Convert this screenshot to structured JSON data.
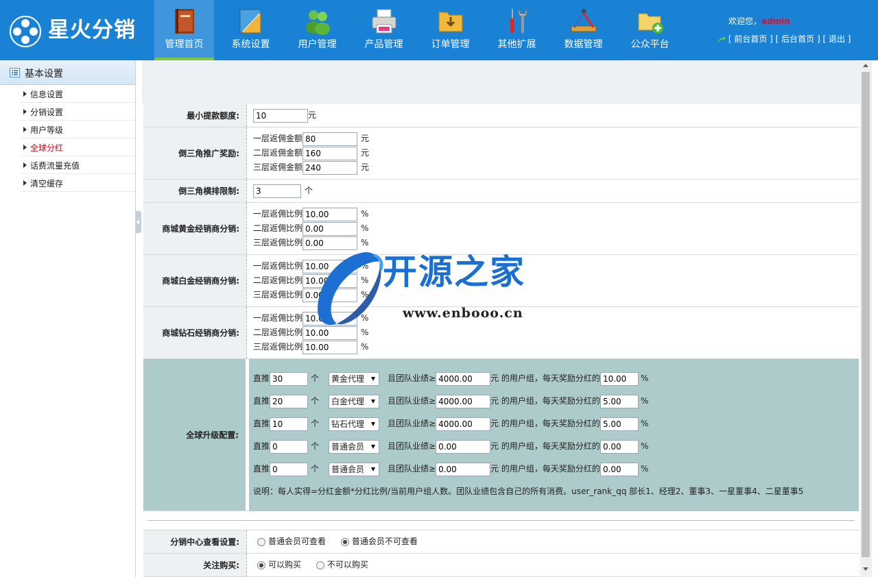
{
  "app": {
    "logo_text": "星火分销"
  },
  "nav": [
    {
      "label": "管理首页",
      "icon": "book-icon",
      "active": true
    },
    {
      "label": "系统设置",
      "icon": "ruler-icon",
      "active": false
    },
    {
      "label": "用户管理",
      "icon": "users-icon",
      "active": false
    },
    {
      "label": "产品管理",
      "icon": "printer-icon",
      "active": false
    },
    {
      "label": "订单管理",
      "icon": "folder-icon",
      "active": false
    },
    {
      "label": "其他扩展",
      "icon": "tools-icon",
      "active": false
    },
    {
      "label": "数据管理",
      "icon": "drafting-icon",
      "active": false
    },
    {
      "label": "公众平台",
      "icon": "folder-add-icon",
      "active": false
    }
  ],
  "user": {
    "welcome": "欢迎您，",
    "name": "admin",
    "links": [
      "[ 前台首页 ]",
      "[ 后台首页 ]",
      "[ 退出 ]"
    ]
  },
  "sidebar": {
    "header": "基本设置",
    "items": [
      {
        "label": "信息设置",
        "active": false
      },
      {
        "label": "分销设置",
        "active": false
      },
      {
        "label": "用户等级",
        "active": false
      },
      {
        "label": "全球分红",
        "active": true
      },
      {
        "label": "话费流量充值",
        "active": false
      },
      {
        "label": "清空缓存",
        "active": false
      }
    ]
  },
  "form": {
    "min_withdraw": {
      "label": "最小提款额度:",
      "value": "10",
      "unit": "元"
    },
    "triangle_reward": {
      "label": "倒三角推广奖励:",
      "rows": [
        {
          "sub": "一层返佣金额",
          "value": "80",
          "unit": "元"
        },
        {
          "sub": "二层返佣金额",
          "value": "160",
          "unit": "元"
        },
        {
          "sub": "三层返佣金额",
          "value": "240",
          "unit": "元"
        }
      ]
    },
    "triangle_limit": {
      "label": "倒三角横排限制:",
      "value": "3",
      "unit": "个"
    },
    "gold": {
      "label": "商城黄金经销商分销:",
      "rows": [
        {
          "sub": "一层返佣比例",
          "value": "10.00",
          "unit": "%"
        },
        {
          "sub": "二层返佣比例",
          "value": "0.00",
          "unit": "%"
        },
        {
          "sub": "三层返佣比例",
          "value": "0.00",
          "unit": "%"
        }
      ]
    },
    "platinum": {
      "label": "商城白金经销商分销:",
      "rows": [
        {
          "sub": "一层返佣比例",
          "value": "10.00",
          "unit": "%"
        },
        {
          "sub": "二层返佣比例",
          "value": "10.00",
          "unit": "%"
        },
        {
          "sub": "三层返佣比例",
          "value": "0.00",
          "unit": "%"
        }
      ]
    },
    "diamond": {
      "label": "商城钻石经销商分销:",
      "rows": [
        {
          "sub": "一层返佣比例",
          "value": "10.00",
          "unit": "%"
        },
        {
          "sub": "二层返佣比例",
          "value": "10.00",
          "unit": "%"
        },
        {
          "sub": "三层返佣比例",
          "value": "10.00",
          "unit": "%"
        }
      ]
    },
    "global_upgrade": {
      "label": "全球升级配置:",
      "text_direct": "直推",
      "text_unit": "个",
      "text_team": "且团队业绩≥",
      "text_group": "元 的用户组，",
      "text_daily": "每天奖励分红的",
      "text_percent": "%",
      "rows": [
        {
          "count": "30",
          "group": "黄金代理",
          "amount": "4000.00",
          "rate": "10.00"
        },
        {
          "count": "20",
          "group": "白金代理",
          "amount": "4000.00",
          "rate": "5.00"
        },
        {
          "count": "10",
          "group": "钻石代理",
          "amount": "4000.00",
          "rate": "5.00"
        },
        {
          "count": "0",
          "group": "普通会员",
          "amount": "0.00",
          "rate": "0.00"
        },
        {
          "count": "0",
          "group": "普通会员",
          "amount": "0.00",
          "rate": "0.00"
        }
      ],
      "note": "说明：每人实得=分红金额*分红比例/当前用户组人数。团队业绩包含自己的所有消费。user_rank_qq 部长1、经理2、董事3、一星董事4、二星董事5"
    },
    "view_setting": {
      "label": "分销中心查看设置:",
      "options": [
        {
          "label": "普通会员可查看",
          "checked": false
        },
        {
          "label": "普通会员不可查看",
          "checked": true
        }
      ]
    },
    "follow_buy": {
      "label": "关注购买:",
      "options": [
        {
          "label": "可以购买",
          "checked": true
        },
        {
          "label": "不可以购买",
          "checked": false
        }
      ]
    }
  },
  "watermark": {
    "text": "开源之家",
    "url": "www.enbooo.cn"
  },
  "colors": {
    "topbar": "#1a82d4",
    "nav_active": "#3f96dc",
    "nav_underline": "#7bc63b",
    "teal_section": "#aecbcb",
    "active_link": "#c4071b"
  }
}
